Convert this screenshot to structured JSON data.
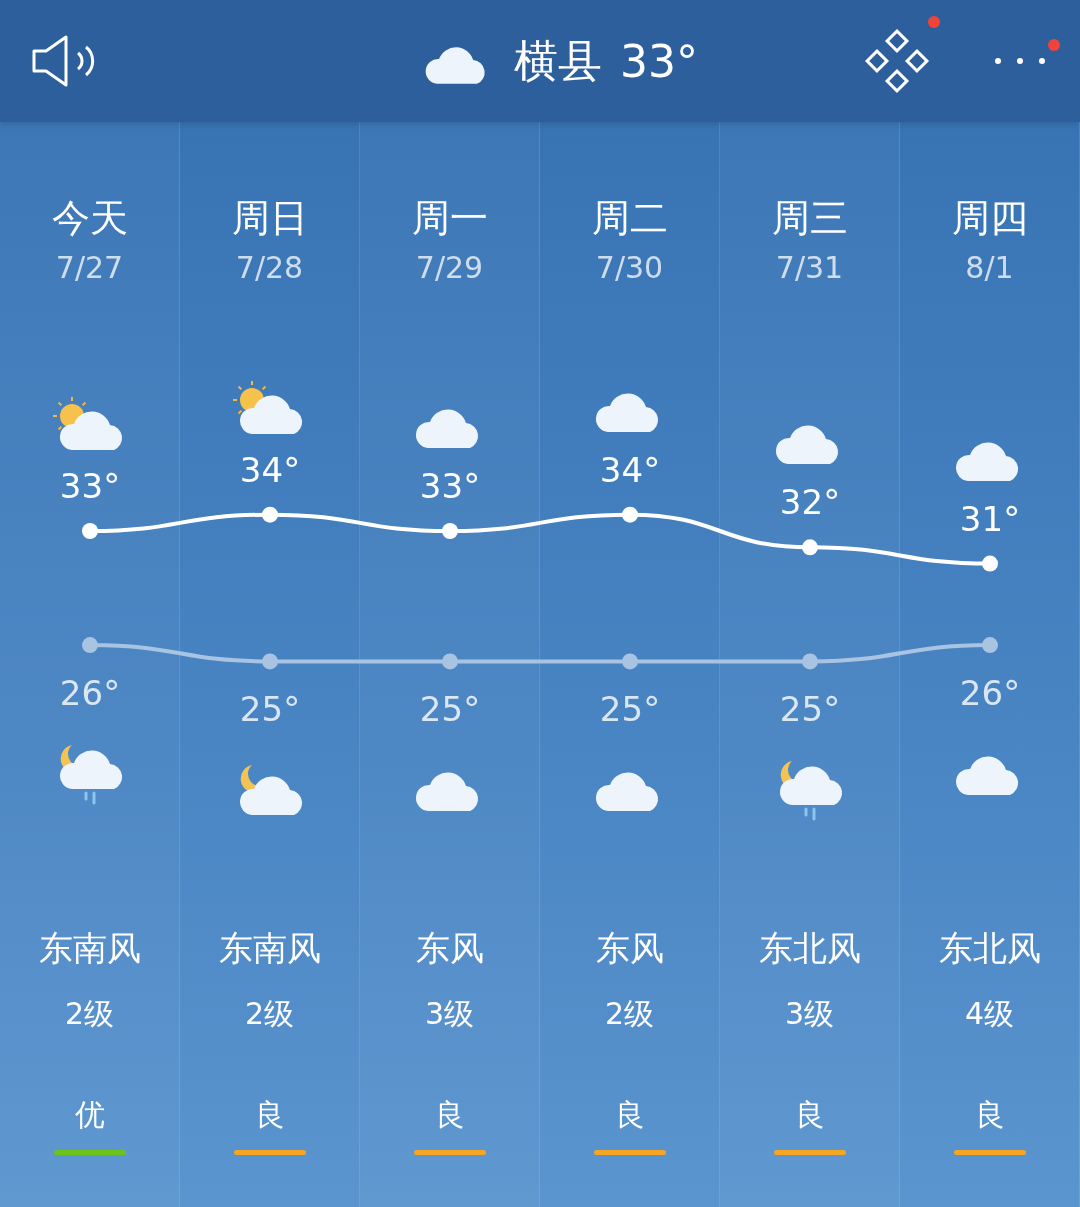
{
  "header": {
    "city": "横县",
    "temperature": "33°"
  },
  "days": [
    {
      "day": "今天",
      "day_icon": {
        "kind": "partly_sunny"
      },
      "night_icon": {
        "kind": "night_rain"
      },
      "wind": "东南风",
      "wind_level": "2级",
      "air_quality": {
        "label": "优",
        "color": "#6cc31c"
      }
    },
    {
      "day": "周日",
      "day_icon": {
        "kind": "partly_sunny"
      },
      "night_icon": {
        "kind": "night_cloudy"
      },
      "wind": "东南风",
      "wind_level": "2级",
      "air_quality": {
        "label": "良",
        "color": "#f5a623"
      }
    },
    {
      "day": "周一",
      "day_icon": {
        "kind": "cloudy"
      },
      "night_icon": {
        "kind": "cloudy"
      },
      "wind": "东风",
      "wind_level": "3级",
      "air_quality": {
        "label": "良",
        "color": "#f5a623"
      }
    },
    {
      "day": "周二",
      "day_icon": {
        "kind": "cloudy"
      },
      "night_icon": {
        "kind": "cloudy"
      },
      "wind": "东风",
      "wind_level": "2级",
      "air_quality": {
        "label": "良",
        "color": "#f5a623"
      }
    },
    {
      "day": "周三",
      "day_icon": {
        "kind": "cloudy"
      },
      "night_icon": {
        "kind": "night_rain"
      },
      "wind": "东北风",
      "wind_level": "3级",
      "air_quality": {
        "label": "良",
        "color": "#f5a623"
      }
    },
    {
      "day": "周四",
      "day_icon": {
        "kind": "cloudy"
      },
      "night_icon": {
        "kind": "cloudy"
      },
      "wind": "东北风",
      "wind_level": "4级",
      "air_quality": {
        "label": "良",
        "color": "#f5a623"
      }
    }
  ],
  "chart_data": {
    "type": "line",
    "categories": [
      "7/27",
      "7/28",
      "7/29",
      "7/30",
      "7/31",
      "8/1"
    ],
    "series": [
      {
        "color": "#ffffff",
        "marker": "circle",
        "values": [
          33,
          34,
          33,
          34,
          32,
          31
        ],
        "value_labels": [
          "33°",
          "34°",
          "33°",
          "34°",
          "32°",
          "31°"
        ]
      },
      {
        "color": "#a9c3e2",
        "marker": "circle",
        "values": [
          26,
          25,
          25,
          25,
          25,
          26
        ],
        "value_labels": [
          "26°",
          "25°",
          "25°",
          "25°",
          "25°",
          "26°"
        ]
      }
    ]
  }
}
